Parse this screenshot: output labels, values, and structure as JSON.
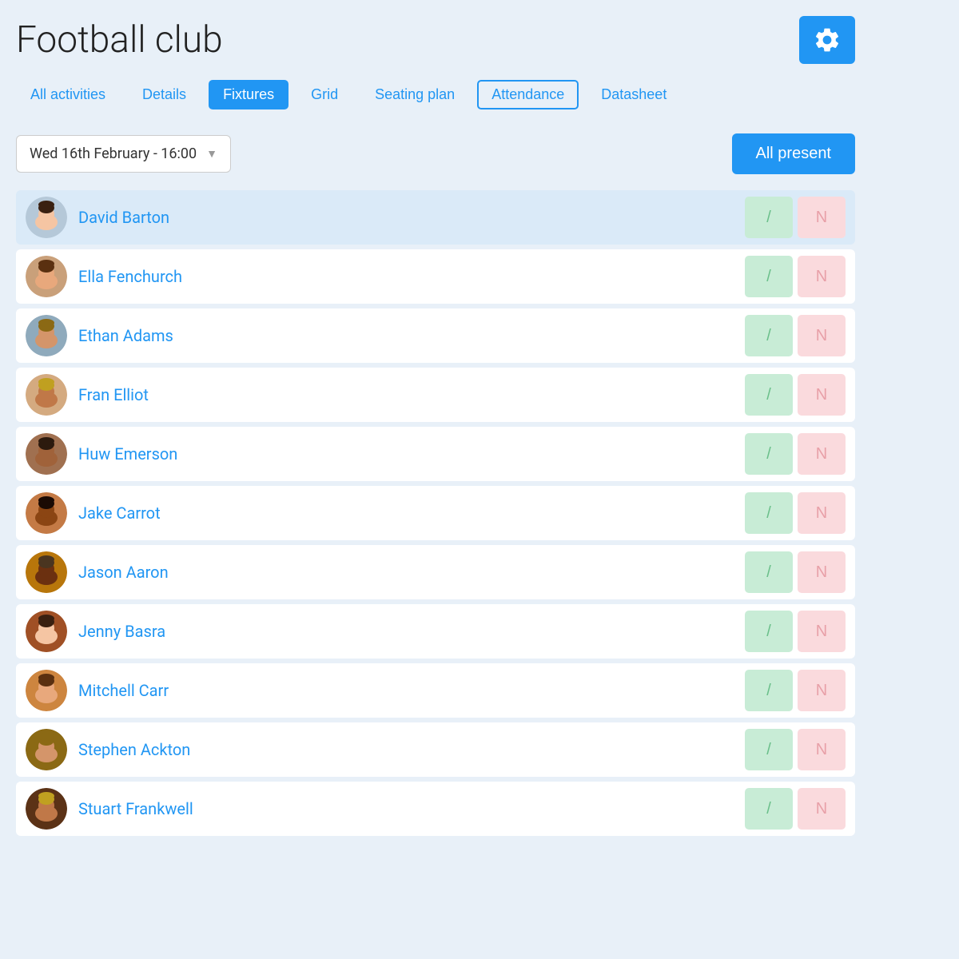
{
  "header": {
    "title": "Football club",
    "settings_label": "Settings"
  },
  "tabs": [
    {
      "id": "all-activities",
      "label": "All activities",
      "active": false
    },
    {
      "id": "details",
      "label": "Details",
      "active": false
    },
    {
      "id": "fixtures",
      "label": "Fixtures",
      "active": true
    },
    {
      "id": "grid",
      "label": "Grid",
      "active": false
    },
    {
      "id": "seating-plan",
      "label": "Seating plan",
      "active": false
    },
    {
      "id": "attendance",
      "label": "Attendance",
      "active": true,
      "outline": true
    },
    {
      "id": "datasheet",
      "label": "Datasheet",
      "active": false
    }
  ],
  "toolbar": {
    "date_label": "Wed 16th February - 16:00",
    "all_present_label": "All present"
  },
  "members": [
    {
      "id": 1,
      "name": "David Barton",
      "highlighted": true,
      "face_color": "#b5c8d8"
    },
    {
      "id": 2,
      "name": "Ella Fenchurch",
      "highlighted": false,
      "face_color": "#c9a07a"
    },
    {
      "id": 3,
      "name": "Ethan Adams",
      "highlighted": false,
      "face_color": "#8faabc"
    },
    {
      "id": 4,
      "name": "Fran Elliot",
      "highlighted": false,
      "face_color": "#d4aa80"
    },
    {
      "id": 5,
      "name": "Huw Emerson",
      "highlighted": false,
      "face_color": "#a07050"
    },
    {
      "id": 6,
      "name": "Jake Carrot",
      "highlighted": false,
      "face_color": "#c47a45"
    },
    {
      "id": 7,
      "name": "Jason Aaron",
      "highlighted": false,
      "face_color": "#b8760b"
    },
    {
      "id": 8,
      "name": "Jenny Basra",
      "highlighted": false,
      "face_color": "#a05025"
    },
    {
      "id": 9,
      "name": "Mitchell Carr",
      "highlighted": false,
      "face_color": "#cd853f"
    },
    {
      "id": 10,
      "name": "Stephen Ackton",
      "highlighted": false,
      "face_color": "#8b6914"
    },
    {
      "id": 11,
      "name": "Stuart Frankwell",
      "highlighted": false,
      "face_color": "#5b3216"
    }
  ],
  "attendance_buttons": {
    "present_label": "/",
    "absent_label": "N"
  },
  "colors": {
    "primary": "#2196F3",
    "present_bg": "#c8ecd6",
    "present_text": "#6abf8a",
    "absent_bg": "#fadadd",
    "absent_text": "#e8a0a8"
  }
}
